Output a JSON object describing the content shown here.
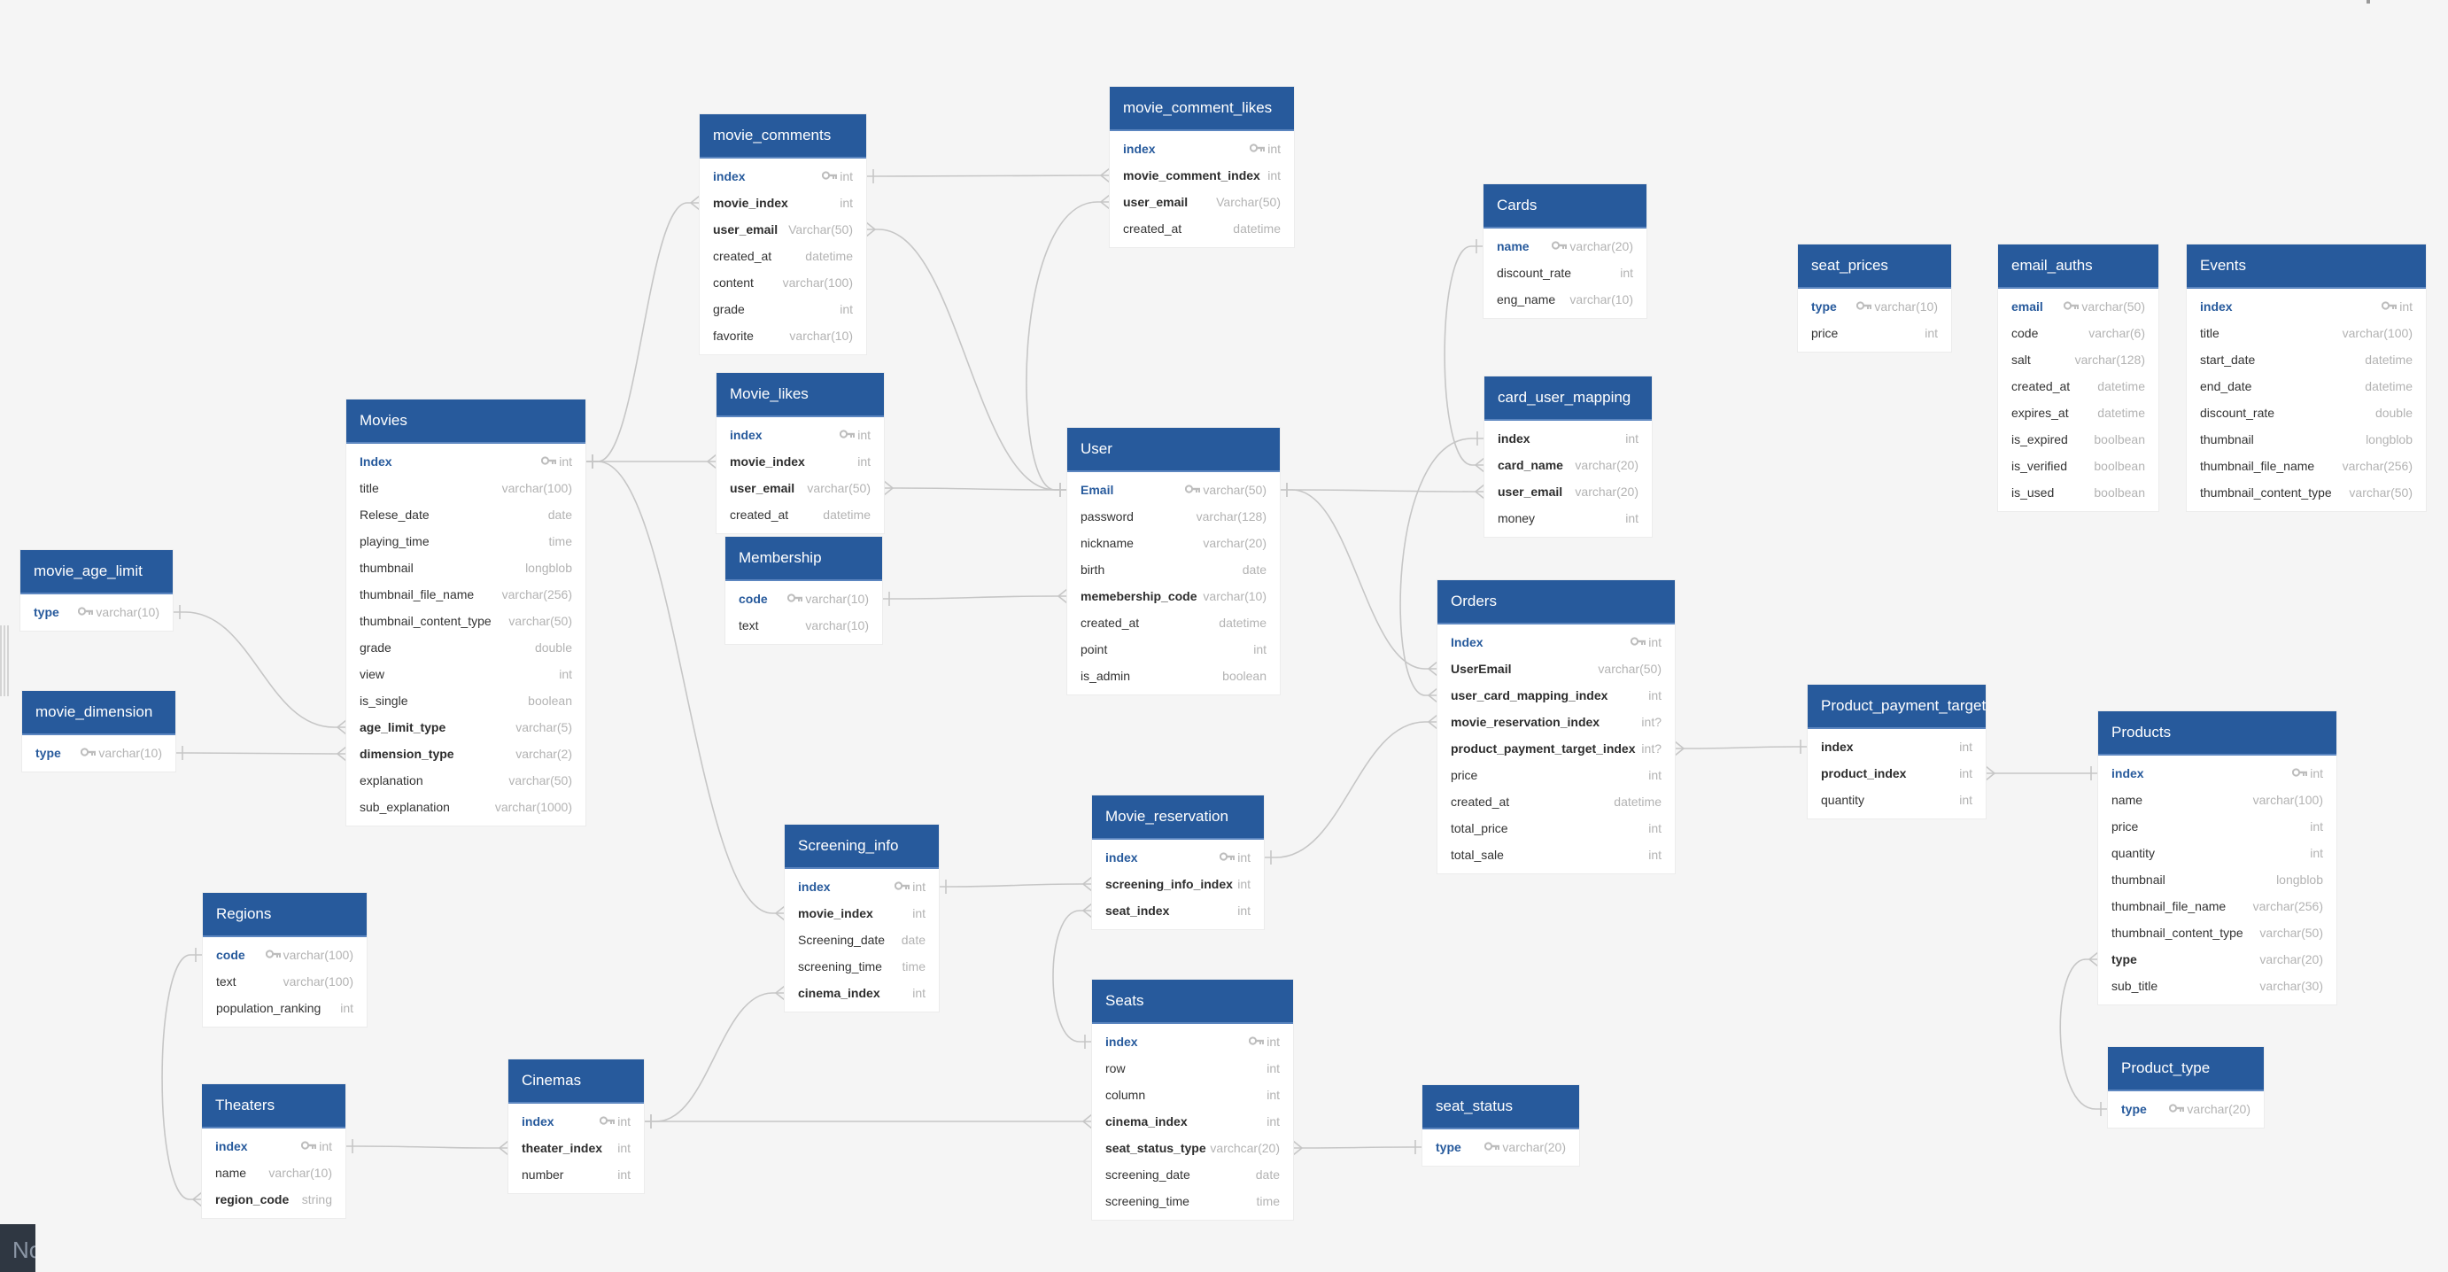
{
  "diagram": {
    "colors": {
      "header": "#275a9c",
      "primary_key": "#275a9c",
      "link": "#c6c6c6",
      "background": "#f5f5f5"
    },
    "tables": [
      {
        "id": "movie_comments",
        "name": "movie_comments",
        "fields": [
          {
            "name": "index",
            "type": "int",
            "pk": true
          },
          {
            "name": "movie_index",
            "type": "int",
            "fk": true
          },
          {
            "name": "user_email",
            "type": "Varchar(50)",
            "fk": true
          },
          {
            "name": "created_at",
            "type": "datetime"
          },
          {
            "name": "content",
            "type": "varchar(100)"
          },
          {
            "name": "grade",
            "type": "int"
          },
          {
            "name": "favorite",
            "type": "varchar(10)"
          }
        ]
      },
      {
        "id": "movie_comment_likes",
        "name": "movie_comment_likes",
        "fields": [
          {
            "name": "index",
            "type": "int",
            "pk": true
          },
          {
            "name": "movie_comment_index",
            "type": "int",
            "fk": true
          },
          {
            "name": "user_email",
            "type": "Varchar(50)",
            "fk": true
          },
          {
            "name": "created_at",
            "type": "datetime"
          }
        ]
      },
      {
        "id": "cards",
        "name": "Cards",
        "fields": [
          {
            "name": "name",
            "type": "varchar(20)",
            "pk": true
          },
          {
            "name": "discount_rate",
            "type": "int"
          },
          {
            "name": "eng_name",
            "type": "varchar(10)"
          }
        ]
      },
      {
        "id": "seat_prices",
        "name": "seat_prices",
        "fields": [
          {
            "name": "type",
            "type": "varchar(10)",
            "pk": true
          },
          {
            "name": "price",
            "type": "int"
          }
        ]
      },
      {
        "id": "email_auths",
        "name": "email_auths",
        "fields": [
          {
            "name": "email",
            "type": "varchar(50)",
            "pk": true
          },
          {
            "name": "code",
            "type": "varchar(6)"
          },
          {
            "name": "salt",
            "type": "varchar(128)"
          },
          {
            "name": "created_at",
            "type": "datetime"
          },
          {
            "name": "expires_at",
            "type": "datetime"
          },
          {
            "name": "is_expired",
            "type": "boolbean"
          },
          {
            "name": "is_verified",
            "type": "boolbean"
          },
          {
            "name": "is_used",
            "type": "boolbean"
          }
        ]
      },
      {
        "id": "events",
        "name": "Events",
        "fields": [
          {
            "name": "index",
            "type": "int",
            "pk": true
          },
          {
            "name": "title",
            "type": "varchar(100)"
          },
          {
            "name": "start_date",
            "type": "datetime"
          },
          {
            "name": "end_date",
            "type": "datetime"
          },
          {
            "name": "discount_rate",
            "type": "double"
          },
          {
            "name": "thumbnail",
            "type": "longblob"
          },
          {
            "name": "thumbnail_file_name",
            "type": "varchar(256)"
          },
          {
            "name": "thumbnail_content_type",
            "type": "varchar(50)"
          }
        ]
      },
      {
        "id": "movies",
        "name": "Movies",
        "fields": [
          {
            "name": "Index",
            "type": "int",
            "pk": true
          },
          {
            "name": "title",
            "type": "varchar(100)"
          },
          {
            "name": "Relese_date",
            "type": "date"
          },
          {
            "name": "playing_time",
            "type": "time"
          },
          {
            "name": "thumbnail",
            "type": "longblob"
          },
          {
            "name": "thumbnail_file_name",
            "type": "varchar(256)"
          },
          {
            "name": "thumbnail_content_type",
            "type": "varchar(50)"
          },
          {
            "name": "grade",
            "type": "double"
          },
          {
            "name": "view",
            "type": "int"
          },
          {
            "name": "is_single",
            "type": "boolean"
          },
          {
            "name": "age_limit_type",
            "type": "varchar(5)",
            "fk": true
          },
          {
            "name": "dimension_type",
            "type": "varchar(2)",
            "fk": true
          },
          {
            "name": "explanation",
            "type": "varchar(50)"
          },
          {
            "name": "sub_explanation",
            "type": "varchar(1000)"
          }
        ]
      },
      {
        "id": "movie_likes",
        "name": "Movie_likes",
        "fields": [
          {
            "name": "index",
            "type": "int",
            "pk": true
          },
          {
            "name": "movie_index",
            "type": "int",
            "fk": true
          },
          {
            "name": "user_email",
            "type": "varchar(50)",
            "fk": true
          },
          {
            "name": "created_at",
            "type": "datetime"
          }
        ]
      },
      {
        "id": "membership",
        "name": "Membership",
        "fields": [
          {
            "name": "code",
            "type": "varchar(10)",
            "pk": true
          },
          {
            "name": "text",
            "type": "varchar(10)"
          }
        ]
      },
      {
        "id": "user",
        "name": "User",
        "fields": [
          {
            "name": "Email",
            "type": "varchar(50)",
            "pk": true
          },
          {
            "name": "password",
            "type": "varchar(128)"
          },
          {
            "name": "nickname",
            "type": "varchar(20)"
          },
          {
            "name": "birth",
            "type": "date"
          },
          {
            "name": "memebership_code",
            "type": "varchar(10)",
            "fk": true
          },
          {
            "name": "created_at",
            "type": "datetime"
          },
          {
            "name": "point",
            "type": "int"
          },
          {
            "name": "is_admin",
            "type": "boolean"
          }
        ]
      },
      {
        "id": "card_user_mapping",
        "name": "card_user_mapping",
        "fields": [
          {
            "name": "index",
            "type": "int",
            "fk": true
          },
          {
            "name": "card_name",
            "type": "varchar(20)",
            "fk": true
          },
          {
            "name": "user_email",
            "type": "varchar(20)",
            "fk": true
          },
          {
            "name": "money",
            "type": "int"
          }
        ]
      },
      {
        "id": "movie_age_limit",
        "name": "movie_age_limit",
        "fields": [
          {
            "name": "type",
            "type": "varchar(10)",
            "pk": true
          }
        ]
      },
      {
        "id": "movie_dimension",
        "name": "movie_dimension",
        "fields": [
          {
            "name": "type",
            "type": "varchar(10)",
            "pk": true
          }
        ]
      },
      {
        "id": "orders",
        "name": "Orders",
        "fields": [
          {
            "name": "Index",
            "type": "int",
            "pk": true
          },
          {
            "name": "UserEmail",
            "type": "varchar(50)",
            "fk": true
          },
          {
            "name": "user_card_mapping_index",
            "type": "int",
            "fk": true
          },
          {
            "name": "movie_reservation_index",
            "type": "int?",
            "fk": true
          },
          {
            "name": "product_payment_target_index",
            "type": "int?",
            "fk": true
          },
          {
            "name": "price",
            "type": "int"
          },
          {
            "name": "created_at",
            "type": "datetime"
          },
          {
            "name": "total_price",
            "type": "int"
          },
          {
            "name": "total_sale",
            "type": "int"
          }
        ]
      },
      {
        "id": "product_payment_target",
        "name": "Product_payment_target",
        "fields": [
          {
            "name": "index",
            "type": "int",
            "fk": true
          },
          {
            "name": "product_index",
            "type": "int",
            "fk": true
          },
          {
            "name": "quantity",
            "type": "int"
          }
        ]
      },
      {
        "id": "products",
        "name": "Products",
        "fields": [
          {
            "name": "index",
            "type": "int",
            "pk": true
          },
          {
            "name": "name",
            "type": "varchar(100)"
          },
          {
            "name": "price",
            "type": "int"
          },
          {
            "name": "quantity",
            "type": "int"
          },
          {
            "name": "thumbnail",
            "type": "longblob"
          },
          {
            "name": "thumbnail_file_name",
            "type": "varchar(256)"
          },
          {
            "name": "thumbnail_content_type",
            "type": "varchar(50)"
          },
          {
            "name": "type",
            "type": "varchar(20)",
            "fk": true
          },
          {
            "name": "sub_title",
            "type": "varchar(30)"
          }
        ]
      },
      {
        "id": "screening_info",
        "name": "Screening_info",
        "fields": [
          {
            "name": "index",
            "type": "int",
            "pk": true
          },
          {
            "name": "movie_index",
            "type": "int",
            "fk": true
          },
          {
            "name": "Screening_date",
            "type": "date"
          },
          {
            "name": "screening_time",
            "type": "time"
          },
          {
            "name": "cinema_index",
            "type": "int",
            "fk": true
          }
        ]
      },
      {
        "id": "movie_reservation",
        "name": "Movie_reservation",
        "fields": [
          {
            "name": "index",
            "type": "int",
            "pk": true
          },
          {
            "name": "screening_info_index",
            "type": "int",
            "fk": true
          },
          {
            "name": "seat_index",
            "type": "int",
            "fk": true
          }
        ]
      },
      {
        "id": "regions",
        "name": "Regions",
        "fields": [
          {
            "name": "code",
            "type": "varchar(100)",
            "pk": true
          },
          {
            "name": "text",
            "type": "varchar(100)"
          },
          {
            "name": "population_ranking",
            "type": "int"
          }
        ]
      },
      {
        "id": "seats",
        "name": "Seats",
        "fields": [
          {
            "name": "index",
            "type": "int",
            "pk": true
          },
          {
            "name": "row",
            "type": "int"
          },
          {
            "name": "column",
            "type": "int"
          },
          {
            "name": "cinema_index",
            "type": "int",
            "fk": true
          },
          {
            "name": "seat_status_type",
            "type": "varchcar(20)",
            "fk": true
          },
          {
            "name": "screening_date",
            "type": "date"
          },
          {
            "name": "screening_time",
            "type": "time"
          }
        ]
      },
      {
        "id": "product_type",
        "name": "Product_type",
        "fields": [
          {
            "name": "type",
            "type": "varchar(20)",
            "pk": true
          }
        ]
      },
      {
        "id": "theaters",
        "name": "Theaters",
        "fields": [
          {
            "name": "index",
            "type": "int",
            "pk": true
          },
          {
            "name": "name",
            "type": "varchar(10)"
          },
          {
            "name": "region_code",
            "type": "string",
            "fk": true
          }
        ]
      },
      {
        "id": "cinemas",
        "name": "Cinemas",
        "fields": [
          {
            "name": "index",
            "type": "int",
            "pk": true
          },
          {
            "name": "theater_index",
            "type": "int",
            "fk": true
          },
          {
            "name": "number",
            "type": "int"
          }
        ]
      },
      {
        "id": "seat_status",
        "name": "seat_status",
        "fields": [
          {
            "name": "type",
            "type": "varchar(20)",
            "pk": true
          }
        ]
      }
    ],
    "relations": [
      {
        "from": "movies.Index",
        "to": "movie_comments.movie_index",
        "cardinality": "one-to-many"
      },
      {
        "from": "movies.Index",
        "to": "movie_likes.movie_index",
        "cardinality": "one-to-many"
      },
      {
        "from": "movies.Index",
        "to": "screening_info.movie_index",
        "cardinality": "one-to-many"
      },
      {
        "from": "movie_comments.index",
        "to": "movie_comment_likes.movie_comment_index",
        "cardinality": "one-to-many"
      },
      {
        "from": "user.Email",
        "to": "movie_comments.user_email",
        "cardinality": "one-to-many"
      },
      {
        "from": "user.Email",
        "to": "movie_comment_likes.user_email",
        "cardinality": "one-to-many"
      },
      {
        "from": "user.Email",
        "to": "movie_likes.user_email",
        "cardinality": "one-to-many"
      },
      {
        "from": "user.Email",
        "to": "card_user_mapping.user_email",
        "cardinality": "one-to-many"
      },
      {
        "from": "user.Email",
        "to": "orders.UserEmail",
        "cardinality": "one-to-many"
      },
      {
        "from": "membership.code",
        "to": "user.memebership_code",
        "cardinality": "one-to-many"
      },
      {
        "from": "cards.name",
        "to": "card_user_mapping.card_name",
        "cardinality": "one-to-many"
      },
      {
        "from": "card_user_mapping.index",
        "to": "orders.user_card_mapping_index",
        "cardinality": "one-to-many"
      },
      {
        "from": "movie_age_limit.type",
        "to": "movies.age_limit_type",
        "cardinality": "one-to-many"
      },
      {
        "from": "movie_dimension.type",
        "to": "movies.dimension_type",
        "cardinality": "one-to-many"
      },
      {
        "from": "movie_reservation.index",
        "to": "orders.movie_reservation_index",
        "cardinality": "one-to-many"
      },
      {
        "from": "product_payment_target.index",
        "to": "orders.product_payment_target_index",
        "cardinality": "one-to-many"
      },
      {
        "from": "products.index",
        "to": "product_payment_target.product_index",
        "cardinality": "one-to-many"
      },
      {
        "from": "product_type.type",
        "to": "products.type",
        "cardinality": "one-to-many"
      },
      {
        "from": "screening_info.index",
        "to": "movie_reservation.screening_info_index",
        "cardinality": "one-to-many"
      },
      {
        "from": "seats.index",
        "to": "movie_reservation.seat_index",
        "cardinality": "one-to-many"
      },
      {
        "from": "cinemas.index",
        "to": "screening_info.cinema_index",
        "cardinality": "one-to-many"
      },
      {
        "from": "cinemas.index",
        "to": "seats.cinema_index",
        "cardinality": "one-to-many"
      },
      {
        "from": "seat_status.type",
        "to": "seats.seat_status_type",
        "cardinality": "one-to-many"
      },
      {
        "from": "theaters.index",
        "to": "cinemas.theater_index",
        "cardinality": "one-to-many"
      },
      {
        "from": "regions.code",
        "to": "theaters.region_code",
        "cardinality": "one-to-many"
      }
    ],
    "key_icon": "key-icon"
  },
  "overlay": {
    "note_label": "No"
  }
}
